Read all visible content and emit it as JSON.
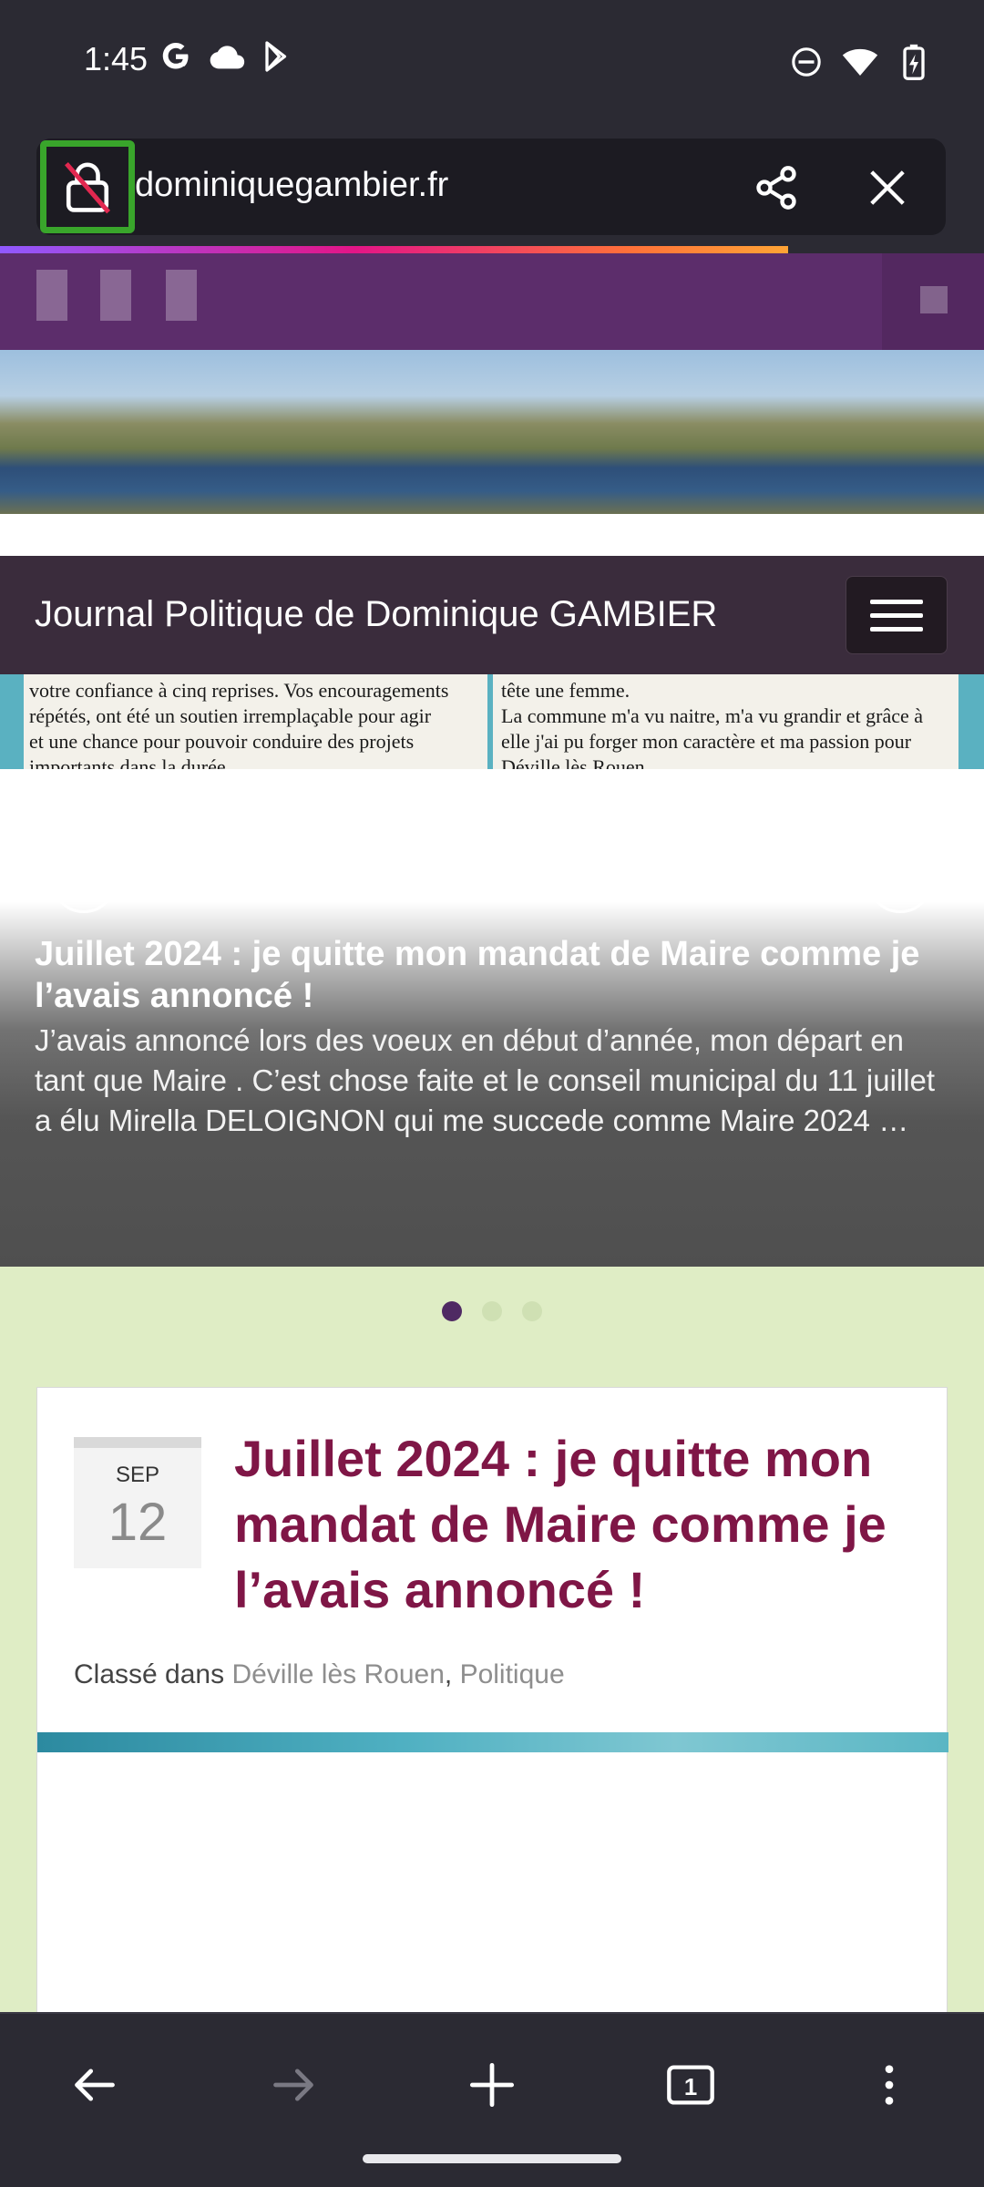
{
  "status_bar": {
    "time": "1:45",
    "left_icons": [
      "google-icon",
      "cloud-icon",
      "play-store-icon"
    ],
    "right_icons": [
      "do-not-disturb-icon",
      "wifi-icon",
      "battery-charging-icon"
    ]
  },
  "browser": {
    "url": "dominiquegambier.fr",
    "load_progress": 0.8,
    "toolbar": {
      "tab_count": "1",
      "buttons": [
        "back-icon",
        "forward-icon",
        "new-tab-icon",
        "tabs-icon",
        "more-icon"
      ]
    }
  },
  "site": {
    "title": "Journal Politique de Dominique GAMBIER"
  },
  "slider": {
    "newspaper_left": [
      "votre confiance à cinq reprises. Vos encouragements",
      "répétés, ont été un soutien irremplaçable pour agir",
      "et une chance pour pouvoir conduire des projets",
      "importants dans la durée."
    ],
    "newspaper_right": [
      "tête une femme.",
      "La commune m'a vu naitre, m'a vu grandir et grâce à",
      "elle j'ai pu forger mon caractère et ma passion pour",
      "Déville lès Rouen"
    ],
    "title": "Juillet 2024 : je quitte mon mandat de Maire comme je l’avais annoncé !",
    "excerpt": "J’avais annoncé lors des voeux en début d’année, mon départ en tant que Maire . C’est chose faite et le conseil municipal du 11 juillet a élu Mirella DELOIGNON qui me succede comme Maire 2024 …",
    "slide_count": 3,
    "active_slide": 1
  },
  "post": {
    "month": "SEP",
    "day": "12",
    "title": "Juillet 2024 : je quitte mon mandat de Maire comme je l’avais annoncé !",
    "meta_label": "Classé dans",
    "categories": [
      "Déville lès Rouen",
      "Politique"
    ],
    "separator": ", "
  },
  "colors": {
    "accent_purple": "#5c2d6b",
    "post_title": "#7f1646",
    "highlight_green": "#39a52b",
    "page_bg": "#dfedc5"
  }
}
